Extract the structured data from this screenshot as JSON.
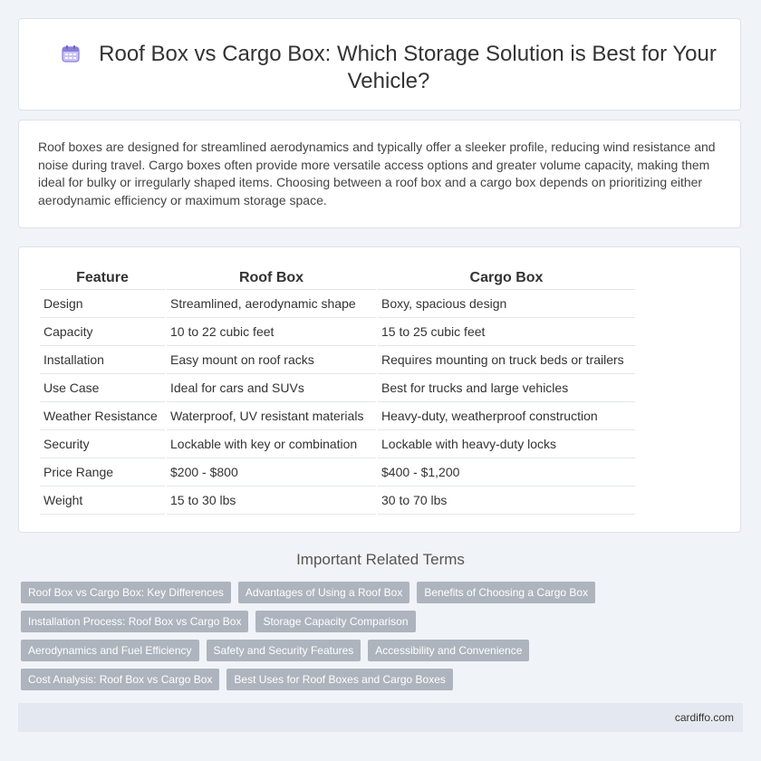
{
  "header": {
    "title": "Roof Box vs Cargo Box: Which Storage Solution is Best for Your Vehicle?",
    "icon": "calendar-icon"
  },
  "intro": {
    "text": "Roof boxes are designed for streamlined aerodynamics and typically offer a sleeker profile, reducing wind resistance and noise during travel. Cargo boxes often provide more versatile access options and greater volume capacity, making them ideal for bulky or irregularly shaped items. Choosing between a roof box and a cargo box depends on prioritizing either aerodynamic efficiency or maximum storage space."
  },
  "table": {
    "headers": [
      "Feature",
      "Roof Box",
      "Cargo Box"
    ],
    "rows": [
      [
        "Design",
        "Streamlined, aerodynamic shape",
        "Boxy, spacious design"
      ],
      [
        "Capacity",
        "10 to 22 cubic feet",
        "15 to 25 cubic feet"
      ],
      [
        "Installation",
        "Easy mount on roof racks",
        "Requires mounting on truck beds or trailers"
      ],
      [
        "Use Case",
        "Ideal for cars and SUVs",
        "Best for trucks and large vehicles"
      ],
      [
        "Weather Resistance",
        "Waterproof, UV resistant materials",
        "Heavy-duty, weatherproof construction"
      ],
      [
        "Security",
        "Lockable with key or combination",
        "Lockable with heavy-duty locks"
      ],
      [
        "Price Range",
        "$200 - $800",
        "$400 - $1,200"
      ],
      [
        "Weight",
        "15 to 30 lbs",
        "30 to 70 lbs"
      ]
    ]
  },
  "related": {
    "heading": "Important Related Terms",
    "tags": [
      "Roof Box vs Cargo Box: Key Differences",
      "Advantages of Using a Roof Box",
      "Benefits of Choosing a Cargo Box",
      "Installation Process: Roof Box vs Cargo Box",
      "Storage Capacity Comparison",
      "Aerodynamics and Fuel Efficiency",
      "Safety and Security Features",
      "Accessibility and Convenience",
      "Cost Analysis: Roof Box vs Cargo Box",
      "Best Uses for Roof Boxes and Cargo Boxes"
    ]
  },
  "footer": {
    "site": "cardiffo.com"
  },
  "colors": {
    "background": "#f0f3f8",
    "tag": "#aeb4bd",
    "footer": "#e4e9f1",
    "icon": "#8a7fd8"
  }
}
